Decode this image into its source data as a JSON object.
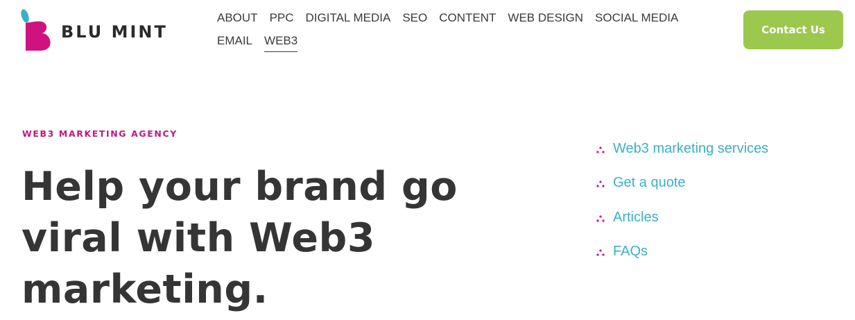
{
  "brand": {
    "name": "BLU MINT",
    "colors": {
      "magenta": "#d0127f",
      "teal": "#3ab0c7",
      "green": "#9bc84d",
      "text": "#353535"
    }
  },
  "nav": {
    "row1": [
      {
        "label": "ABOUT"
      },
      {
        "label": "PPC"
      },
      {
        "label": "DIGITAL MEDIA"
      },
      {
        "label": "SEO"
      },
      {
        "label": "CONTENT"
      },
      {
        "label": "WEB DESIGN"
      },
      {
        "label": "SOCIAL MEDIA"
      }
    ],
    "row2": [
      {
        "label": "EMAIL"
      },
      {
        "label": "WEB3",
        "active": true
      }
    ]
  },
  "header": {
    "contact_label": "Contact Us"
  },
  "hero": {
    "eyebrow": "WEB3 MARKETING AGENCY",
    "title_lines": [
      "Help your brand go",
      "viral with Web3",
      "marketing."
    ]
  },
  "quick_links": {
    "bullet_icon": "three-dots-icon",
    "items": [
      {
        "label": "Web3 marketing services"
      },
      {
        "label": "Get a quote"
      },
      {
        "label": "Articles"
      },
      {
        "label": "FAQs"
      }
    ]
  }
}
